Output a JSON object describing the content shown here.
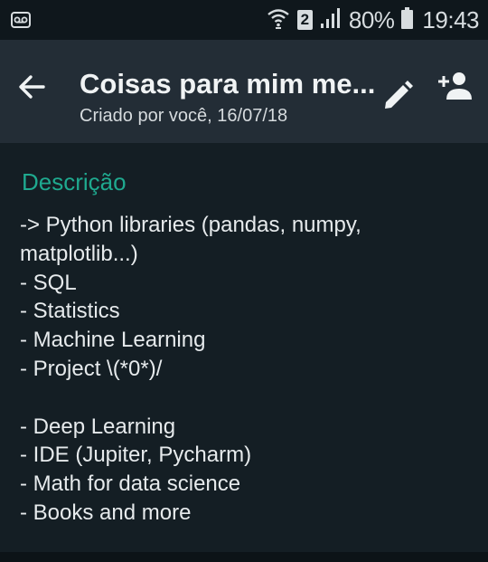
{
  "status_bar": {
    "sim_slot": "2",
    "battery_percent": "80%",
    "time": "19:43",
    "icons": [
      "voicemail-icon",
      "wifi-icon",
      "signal-icon",
      "battery-icon"
    ]
  },
  "header": {
    "title": "Coisas para mim me...",
    "subtitle": "Criado por você, 16/07/18",
    "icons": [
      "back-arrow-icon",
      "pencil-icon",
      "add-person-icon"
    ]
  },
  "description": {
    "heading": "Descrição",
    "text": "-> Python libraries (pandas, numpy,\nmatplotlib...)\n- SQL\n- Statistics\n- Machine Learning\n- Project \\(*0*)/\n\n- Deep Learning\n- IDE (Jupiter, Pycharm)\n- Math for data science\n- Books and more"
  },
  "colors": {
    "accent": "#1fa98f",
    "header_bg": "#232d36",
    "body_bg": "#141e24",
    "status_bg": "#0f171c"
  }
}
